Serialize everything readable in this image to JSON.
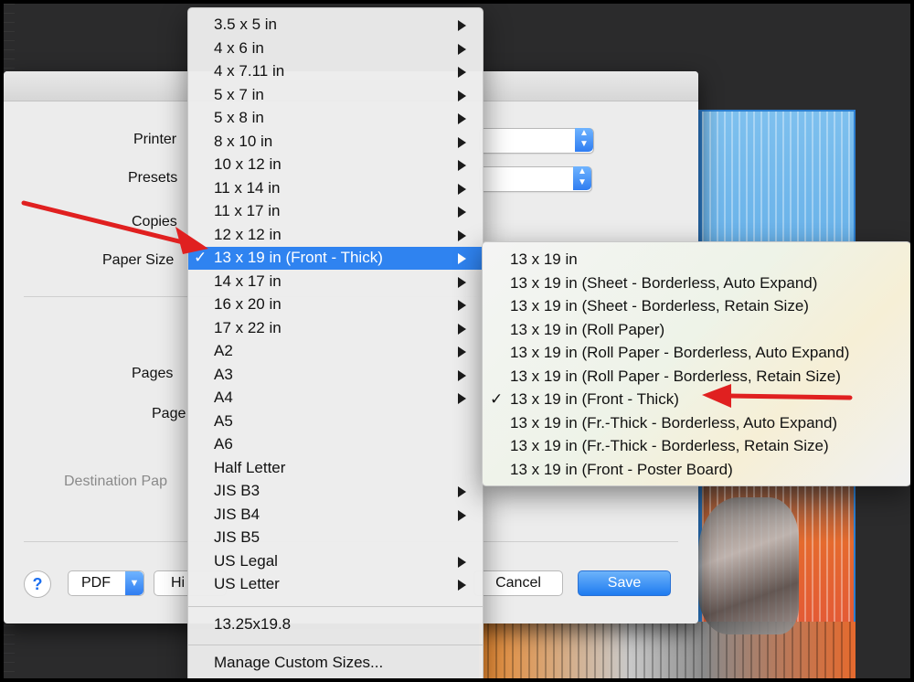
{
  "dialog": {
    "labels": {
      "printer": "Printer",
      "presets": "Presets",
      "copies": "Copies",
      "paper_size": "Paper Size",
      "pages": "Pages",
      "page": "Page",
      "destination": "Destination Pap"
    },
    "buttons": {
      "help": "?",
      "pdf": "PDF",
      "hide_details": "Hi",
      "cancel": "Cancel",
      "save": "Save"
    }
  },
  "menu": {
    "items": [
      {
        "label": "3.5 x 5 in",
        "submenu": true
      },
      {
        "label": "4 x 6 in",
        "submenu": true
      },
      {
        "label": "4 x 7.11 in",
        "submenu": true
      },
      {
        "label": "5 x 7 in",
        "submenu": true
      },
      {
        "label": "5 x 8 in",
        "submenu": true
      },
      {
        "label": "8 x 10 in",
        "submenu": true
      },
      {
        "label": "10 x 12 in",
        "submenu": true
      },
      {
        "label": "11 x 14 in",
        "submenu": true
      },
      {
        "label": "11 x 17 in",
        "submenu": true
      },
      {
        "label": "12 x 12 in",
        "submenu": true
      },
      {
        "label": "13 x 19 in (Front - Thick)",
        "submenu": true,
        "selected": true,
        "check": "✓"
      },
      {
        "label": "14 x 17 in",
        "submenu": true
      },
      {
        "label": "16 x 20 in",
        "submenu": true
      },
      {
        "label": "17 x 22 in",
        "submenu": true
      },
      {
        "label": "A2",
        "submenu": true
      },
      {
        "label": "A3",
        "submenu": true
      },
      {
        "label": "A4",
        "submenu": true
      },
      {
        "label": "A5",
        "submenu": false
      },
      {
        "label": "A6",
        "submenu": false
      },
      {
        "label": "Half Letter",
        "submenu": false
      },
      {
        "label": "JIS B3",
        "submenu": true
      },
      {
        "label": "JIS B4",
        "submenu": true
      },
      {
        "label": "JIS B5",
        "submenu": false
      },
      {
        "label": "US Legal",
        "submenu": true
      },
      {
        "label": "US Letter",
        "submenu": true
      }
    ],
    "custom_item": "13.25x19.8",
    "manage_item": "Manage Custom Sizes..."
  },
  "submenu": {
    "items": [
      {
        "label": "13 x 19 in"
      },
      {
        "label": "13 x 19 in (Sheet - Borderless, Auto Expand)"
      },
      {
        "label": "13 x 19 in (Sheet - Borderless, Retain Size)"
      },
      {
        "label": "13 x 19 in (Roll Paper)"
      },
      {
        "label": "13 x 19 in (Roll Paper - Borderless, Auto Expand)"
      },
      {
        "label": "13 x 19 in (Roll Paper - Borderless, Retain Size)"
      },
      {
        "label": "13 x 19 in (Front - Thick)",
        "check": "✓"
      },
      {
        "label": "13 x 19 in (Fr.-Thick - Borderless, Auto Expand)"
      },
      {
        "label": "13 x 19 in (Fr.-Thick - Borderless, Retain Size)"
      },
      {
        "label": "13 x 19 in (Front - Poster Board)"
      }
    ]
  },
  "colors": {
    "selection": "#2f83f0",
    "annotation_arrow": "#e02020"
  }
}
